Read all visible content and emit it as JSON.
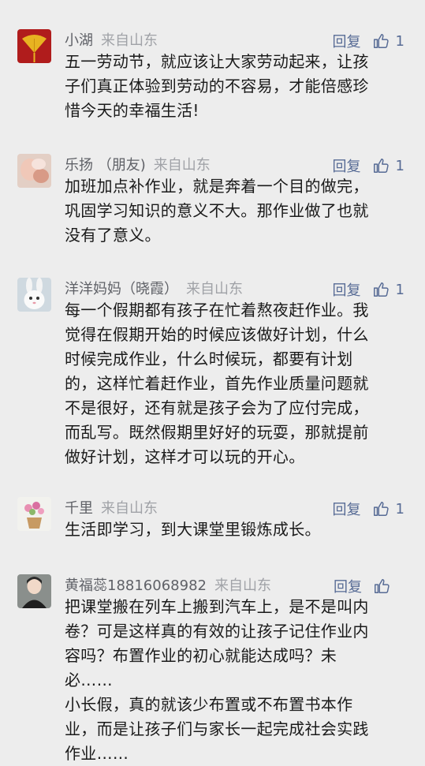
{
  "comments": [
    {
      "name": "小湖",
      "location": "来自山东",
      "reply": "回复",
      "likes": "1",
      "text": "五一劳动节，就应该让大家劳动起来，让孩\n子们真正体验到劳动的不容易，才能倍感珍\n惜今天的幸福生活!"
    },
    {
      "name": "乐扬 （朋友)",
      "location": "来自山东",
      "reply": "回复",
      "likes": "1",
      "text": "加班加点补作业，就是奔着一个目的做完，\n巩固学习知识的意义不大。那作业做了也就\n没有了意义。"
    },
    {
      "name": "洋洋妈妈（晓霞）",
      "location": "来自山东",
      "reply": "回复",
      "likes": "1",
      "text": "每一个假期都有孩子在忙着熬夜赶作业。我\n觉得在假期开始的时候应该做好计划，什么\n时候完成作业，什么时候玩，都要有计划\n的，这样忙着赶作业，首先作业质量问题就\n不是很好，还有就是孩子会为了应付完成，\n而乱写。既然假期里好好的玩耍，那就提前\n做好计划，这样才可以玩的开心。"
    },
    {
      "name": "千里",
      "location": "来自山东",
      "reply": "回复",
      "likes": "1",
      "text": "生活即学习，到大课堂里锻炼成长。"
    },
    {
      "name": "黄福蕊18816068982",
      "location": "来自山东",
      "reply": "回复",
      "likes": "",
      "text": "把课堂搬在列车上搬到汽车上，是不是叫内\n卷？可是这样真的有效的让孩子记住作业内\n容吗？布置作业的初心就能达成吗？未\n必……\n小长假，真的就该少布置或不布置书本作\n业，而是让孩子们与家长一起完成社会实践\n作业……"
    }
  ]
}
